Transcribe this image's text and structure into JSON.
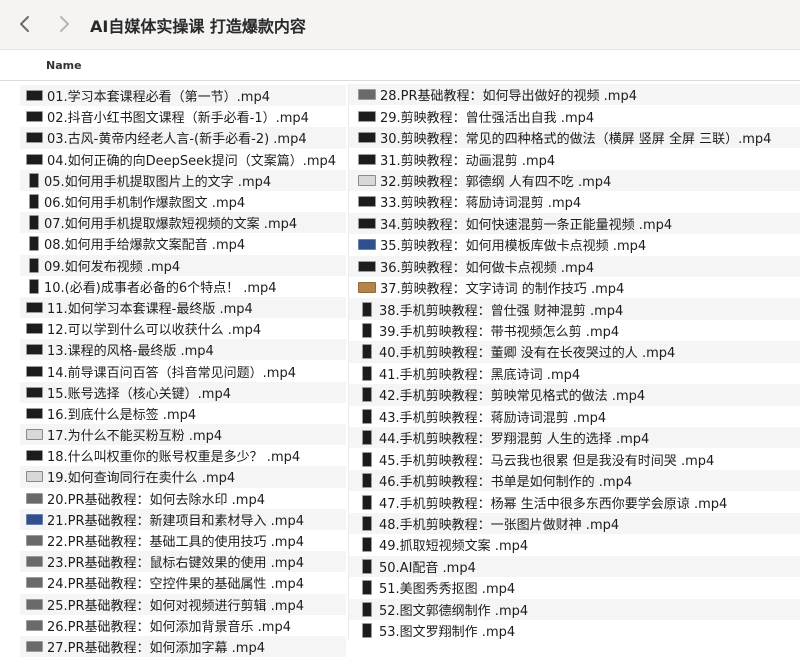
{
  "window": {
    "title": "AI自媒体实操课 打造爆款内容"
  },
  "toolbar": {
    "back_icon": "chevron-left-icon",
    "forward_icon": "chevron-right-icon"
  },
  "columns": {
    "name_header": "Name"
  },
  "files_left": [
    {
      "name": "01.学习本套课程必看（第一节）.mp4",
      "thumb": "dark"
    },
    {
      "name": "02.抖音小红书图文课程（新手必看-1）.mp4",
      "thumb": "dark"
    },
    {
      "name": "03.古风-黄帝内经老人言-(新手必看-2) .mp4",
      "thumb": "dark"
    },
    {
      "name": "04.如何正确的向DeepSeek提问（文案篇）.mp4",
      "thumb": "dark"
    },
    {
      "name": "05.如何用手机提取图片上的文字 .mp4",
      "thumb": "tall"
    },
    {
      "name": "06.如何用手机制作爆款图文 .mp4",
      "thumb": "tall"
    },
    {
      "name": "07.如何用手机提取爆款短视频的文案 .mp4",
      "thumb": "tall"
    },
    {
      "name": "08.如何用手给爆款文案配音 .mp4",
      "thumb": "tall"
    },
    {
      "name": "09.如何发布视频 .mp4",
      "thumb": "tall"
    },
    {
      "name": "10.(必看)成事者必备的6个特点！ .mp4",
      "thumb": "tall"
    },
    {
      "name": "11.如何学习本套课程-最终版 .mp4",
      "thumb": "dark"
    },
    {
      "name": "12.可以学到什么可以收获什么 .mp4",
      "thumb": "dark"
    },
    {
      "name": "13.课程的风格-最终版 .mp4",
      "thumb": "dark"
    },
    {
      "name": "14.前导课百问百答（抖音常见问题）.mp4",
      "thumb": "dark"
    },
    {
      "name": "15.账号选择（核心关键）.mp4",
      "thumb": "dark"
    },
    {
      "name": "16.到底什么是标签 .mp4",
      "thumb": "dark"
    },
    {
      "name": "17.为什么不能买粉互粉 .mp4",
      "thumb": "light"
    },
    {
      "name": "18.什么叫权重你的账号权重是多少？ .mp4",
      "thumb": "dark"
    },
    {
      "name": "19.如何查询同行在卖什么 .mp4",
      "thumb": "light"
    },
    {
      "name": "20.PR基础教程：如何去除水印 .mp4",
      "thumb": "mid"
    },
    {
      "name": "21.PR基础教程：新建项目和素材导入 .mp4",
      "thumb": "blue"
    },
    {
      "name": "22.PR基础教程：基础工具的使用技巧 .mp4",
      "thumb": "mid"
    },
    {
      "name": "23.PR基础教程：鼠标右键效果的使用 .mp4",
      "thumb": "mid"
    },
    {
      "name": "24.PR基础教程：空控件果的基础属性 .mp4",
      "thumb": "mid"
    },
    {
      "name": "25.PR基础教程：如何对视频进行剪辑 .mp4",
      "thumb": "mid"
    },
    {
      "name": "26.PR基础教程：如何添加背景音乐 .mp4",
      "thumb": "mid"
    },
    {
      "name": "27.PR基础教程：如何添加字幕 .mp4",
      "thumb": "mid"
    }
  ],
  "files_right": [
    {
      "name": "28.PR基础教程：如何导出做好的视频 .mp4",
      "thumb": "mid"
    },
    {
      "name": "29.剪映教程：曾仕强活出自我 .mp4",
      "thumb": "dark"
    },
    {
      "name": "30.剪映教程：常见的四种格式的做法（横屏 竖屏 全屏 三联）.mp4",
      "thumb": "dark"
    },
    {
      "name": "31.剪映教程：动画混剪 .mp4",
      "thumb": "dark"
    },
    {
      "name": "32.剪映教程：郭德纲 人有四不吃 .mp4",
      "thumb": "light"
    },
    {
      "name": "33.剪映教程：蒋励诗词混剪 .mp4",
      "thumb": "dark"
    },
    {
      "name": "34.剪映教程：如何快速混剪一条正能量视频 .mp4",
      "thumb": "dark"
    },
    {
      "name": "35.剪映教程：如何用模板库做卡点视频 .mp4",
      "thumb": "blue"
    },
    {
      "name": "36.剪映教程：如何做卡点视频 .mp4",
      "thumb": "dark"
    },
    {
      "name": "37.剪映教程：文字诗词 的制作技巧 .mp4",
      "thumb": "warm"
    },
    {
      "name": "38.手机剪映教程：曾仕强 财神混剪 .mp4",
      "thumb": "tall"
    },
    {
      "name": "39.手机剪映教程：带书视频怎么剪 .mp4",
      "thumb": "tall"
    },
    {
      "name": "40.手机剪映教程：董卿 没有在长夜哭过的人 .mp4",
      "thumb": "tall"
    },
    {
      "name": "41.手机剪映教程：黑底诗词 .mp4",
      "thumb": "tall"
    },
    {
      "name": "42.手机剪映教程：剪映常见格式的做法 .mp4",
      "thumb": "tall"
    },
    {
      "name": "43.手机剪映教程：蒋励诗词混剪 .mp4",
      "thumb": "tall"
    },
    {
      "name": "44.手机剪映教程：罗翔混剪 人生的选择 .mp4",
      "thumb": "tall"
    },
    {
      "name": "45.手机剪映教程：马云我也很累 但是我没有时间哭 .mp4",
      "thumb": "tall"
    },
    {
      "name": "46.手机剪映教程：书单是如何制作的 .mp4",
      "thumb": "tall"
    },
    {
      "name": "47.手机剪映教程：杨幂 生活中很多东西你要学会原谅 .mp4",
      "thumb": "tall"
    },
    {
      "name": "48.手机剪映教程：一张图片做财神 .mp4",
      "thumb": "tall"
    },
    {
      "name": "49.抓取短视频文案 .mp4",
      "thumb": "tall"
    },
    {
      "name": "50.AI配音 .mp4",
      "thumb": "tall"
    },
    {
      "name": "51.美图秀秀抠图 .mp4",
      "thumb": "tall"
    },
    {
      "name": "52.图文郭德纲制作 .mp4",
      "thumb": "tall"
    },
    {
      "name": "53.图文罗翔制作 .mp4",
      "thumb": "tall"
    }
  ]
}
